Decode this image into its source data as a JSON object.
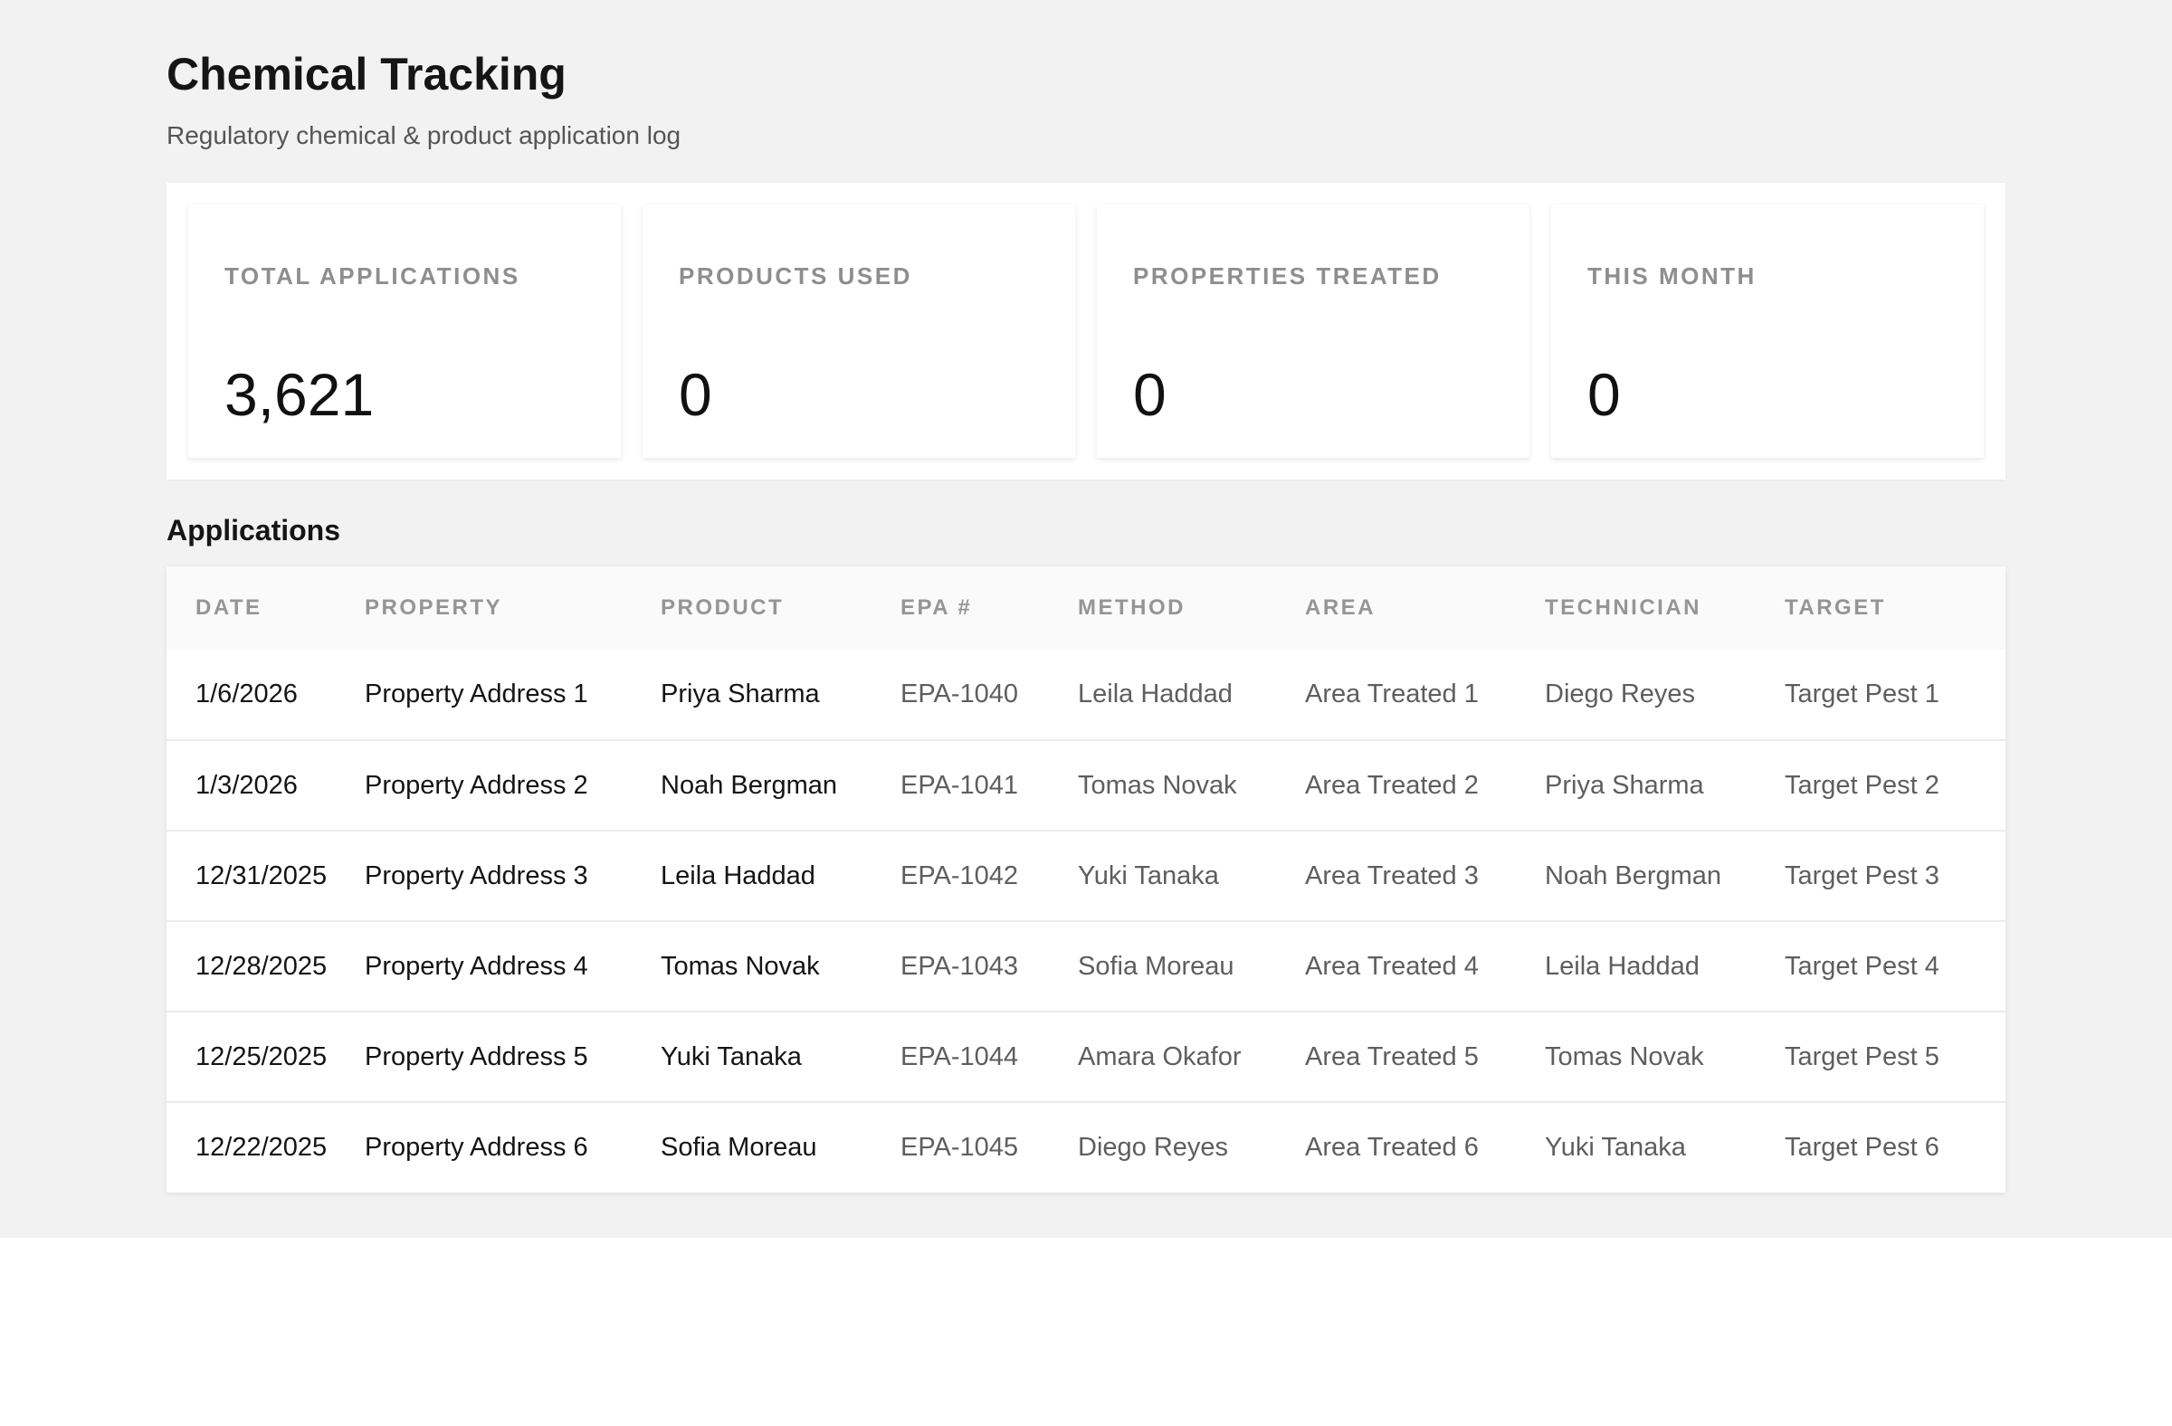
{
  "header": {
    "title": "Chemical Tracking",
    "subtitle": "Regulatory chemical & product application log"
  },
  "stats": [
    {
      "label": "TOTAL APPLICATIONS",
      "value": "3,621"
    },
    {
      "label": "PRODUCTS USED",
      "value": "0"
    },
    {
      "label": "PROPERTIES TREATED",
      "value": "0"
    },
    {
      "label": "THIS MONTH",
      "value": "0"
    }
  ],
  "applications": {
    "section_title": "Applications",
    "columns": [
      "DATE",
      "PROPERTY",
      "PRODUCT",
      "EPA #",
      "METHOD",
      "AREA",
      "TECHNICIAN",
      "TARGET"
    ],
    "rows": [
      [
        "1/6/2026",
        "Property Address 1",
        "Priya Sharma",
        "EPA-1040",
        "Leila Haddad",
        "Area Treated 1",
        "Diego Reyes",
        "Target Pest 1"
      ],
      [
        "1/3/2026",
        "Property Address 2",
        "Noah Bergman",
        "EPA-1041",
        "Tomas Novak",
        "Area Treated 2",
        "Priya Sharma",
        "Target Pest 2"
      ],
      [
        "12/31/2025",
        "Property Address 3",
        "Leila Haddad",
        "EPA-1042",
        "Yuki Tanaka",
        "Area Treated 3",
        "Noah Bergman",
        "Target Pest 3"
      ],
      [
        "12/28/2025",
        "Property Address 4",
        "Tomas Novak",
        "EPA-1043",
        "Sofia Moreau",
        "Area Treated 4",
        "Leila Haddad",
        "Target Pest 4"
      ],
      [
        "12/25/2025",
        "Property Address 5",
        "Yuki Tanaka",
        "EPA-1044",
        "Amara Okafor",
        "Area Treated 5",
        "Tomas Novak",
        "Target Pest 5"
      ],
      [
        "12/22/2025",
        "Property Address 6",
        "Sofia Moreau",
        "EPA-1045",
        "Diego Reyes",
        "Area Treated 6",
        "Yuki Tanaka",
        "Target Pest 6"
      ]
    ]
  }
}
